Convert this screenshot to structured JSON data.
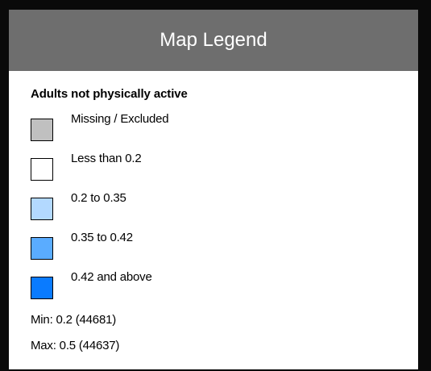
{
  "window": {
    "title": "Map Legend"
  },
  "legend": {
    "title": "Adults not physically active",
    "items": [
      {
        "label": "Missing / Excluded",
        "color": "#c0c0c0"
      },
      {
        "label": "Less than 0.2",
        "color": "#ffffff"
      },
      {
        "label": "0.2 to 0.35",
        "color": "#b3d9ff"
      },
      {
        "label": "0.35 to 0.42",
        "color": "#5aacff"
      },
      {
        "label": "0.42 and above",
        "color": "#0a7bff"
      }
    ]
  },
  "stats": {
    "min": "Min: 0.2 (44681)",
    "max": "Max: 0.5 (44637)"
  }
}
